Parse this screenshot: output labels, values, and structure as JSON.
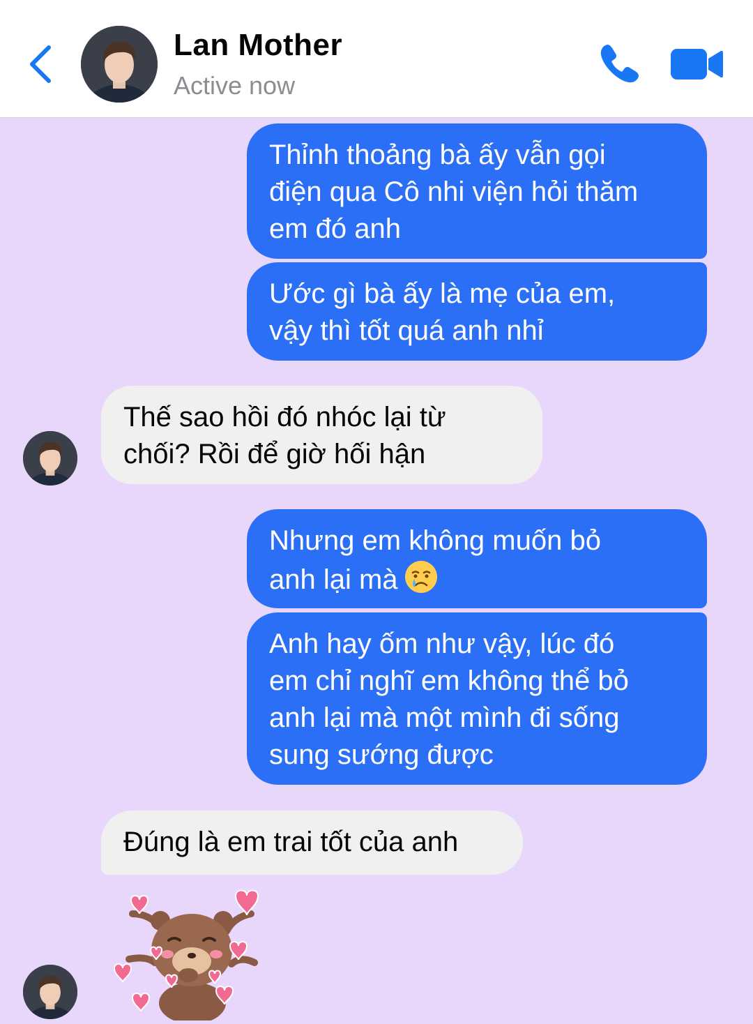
{
  "header": {
    "contact_name": "Lan Mother",
    "status": "Active now",
    "icons": {
      "back": "back-chevron-icon",
      "call": "phone-icon",
      "video": "video-camera-icon"
    },
    "accent_color": "#1877f2"
  },
  "messages": [
    {
      "direction": "outgoing",
      "lines": [
        "Thỉnh thoảng bà ấy vẫn gọi",
        "điện qua Cô nhi viện hỏi thăm",
        "em đó anh"
      ]
    },
    {
      "direction": "outgoing",
      "lines": [
        "Ước gì bà ấy là mẹ của em,",
        "vậy thì tốt quá anh nhỉ"
      ]
    },
    {
      "direction": "incoming",
      "lines": [
        "Thế sao hồi đó nhóc lại từ",
        "chối? Rồi để giờ hối hận"
      ]
    },
    {
      "direction": "outgoing",
      "lines": [
        "Nhưng em không muốn bỏ",
        "anh lại mà"
      ],
      "emoji": "crying-face-emoji"
    },
    {
      "direction": "outgoing",
      "lines": [
        "Anh hay ốm như vậy, lúc đó",
        "em chỉ nghĩ em không thể bỏ",
        "anh lại mà một mình đi sống",
        "sung sướng được"
      ]
    },
    {
      "direction": "incoming",
      "lines": [
        "Đúng là em trai tốt của anh"
      ]
    },
    {
      "direction": "incoming",
      "sticker": "bear-blowing-kisses-sticker"
    }
  ],
  "colors": {
    "chat_background": "#e8d7fb",
    "outgoing_bubble": "#2b6ff6",
    "incoming_bubble": "#f0f0f0"
  }
}
